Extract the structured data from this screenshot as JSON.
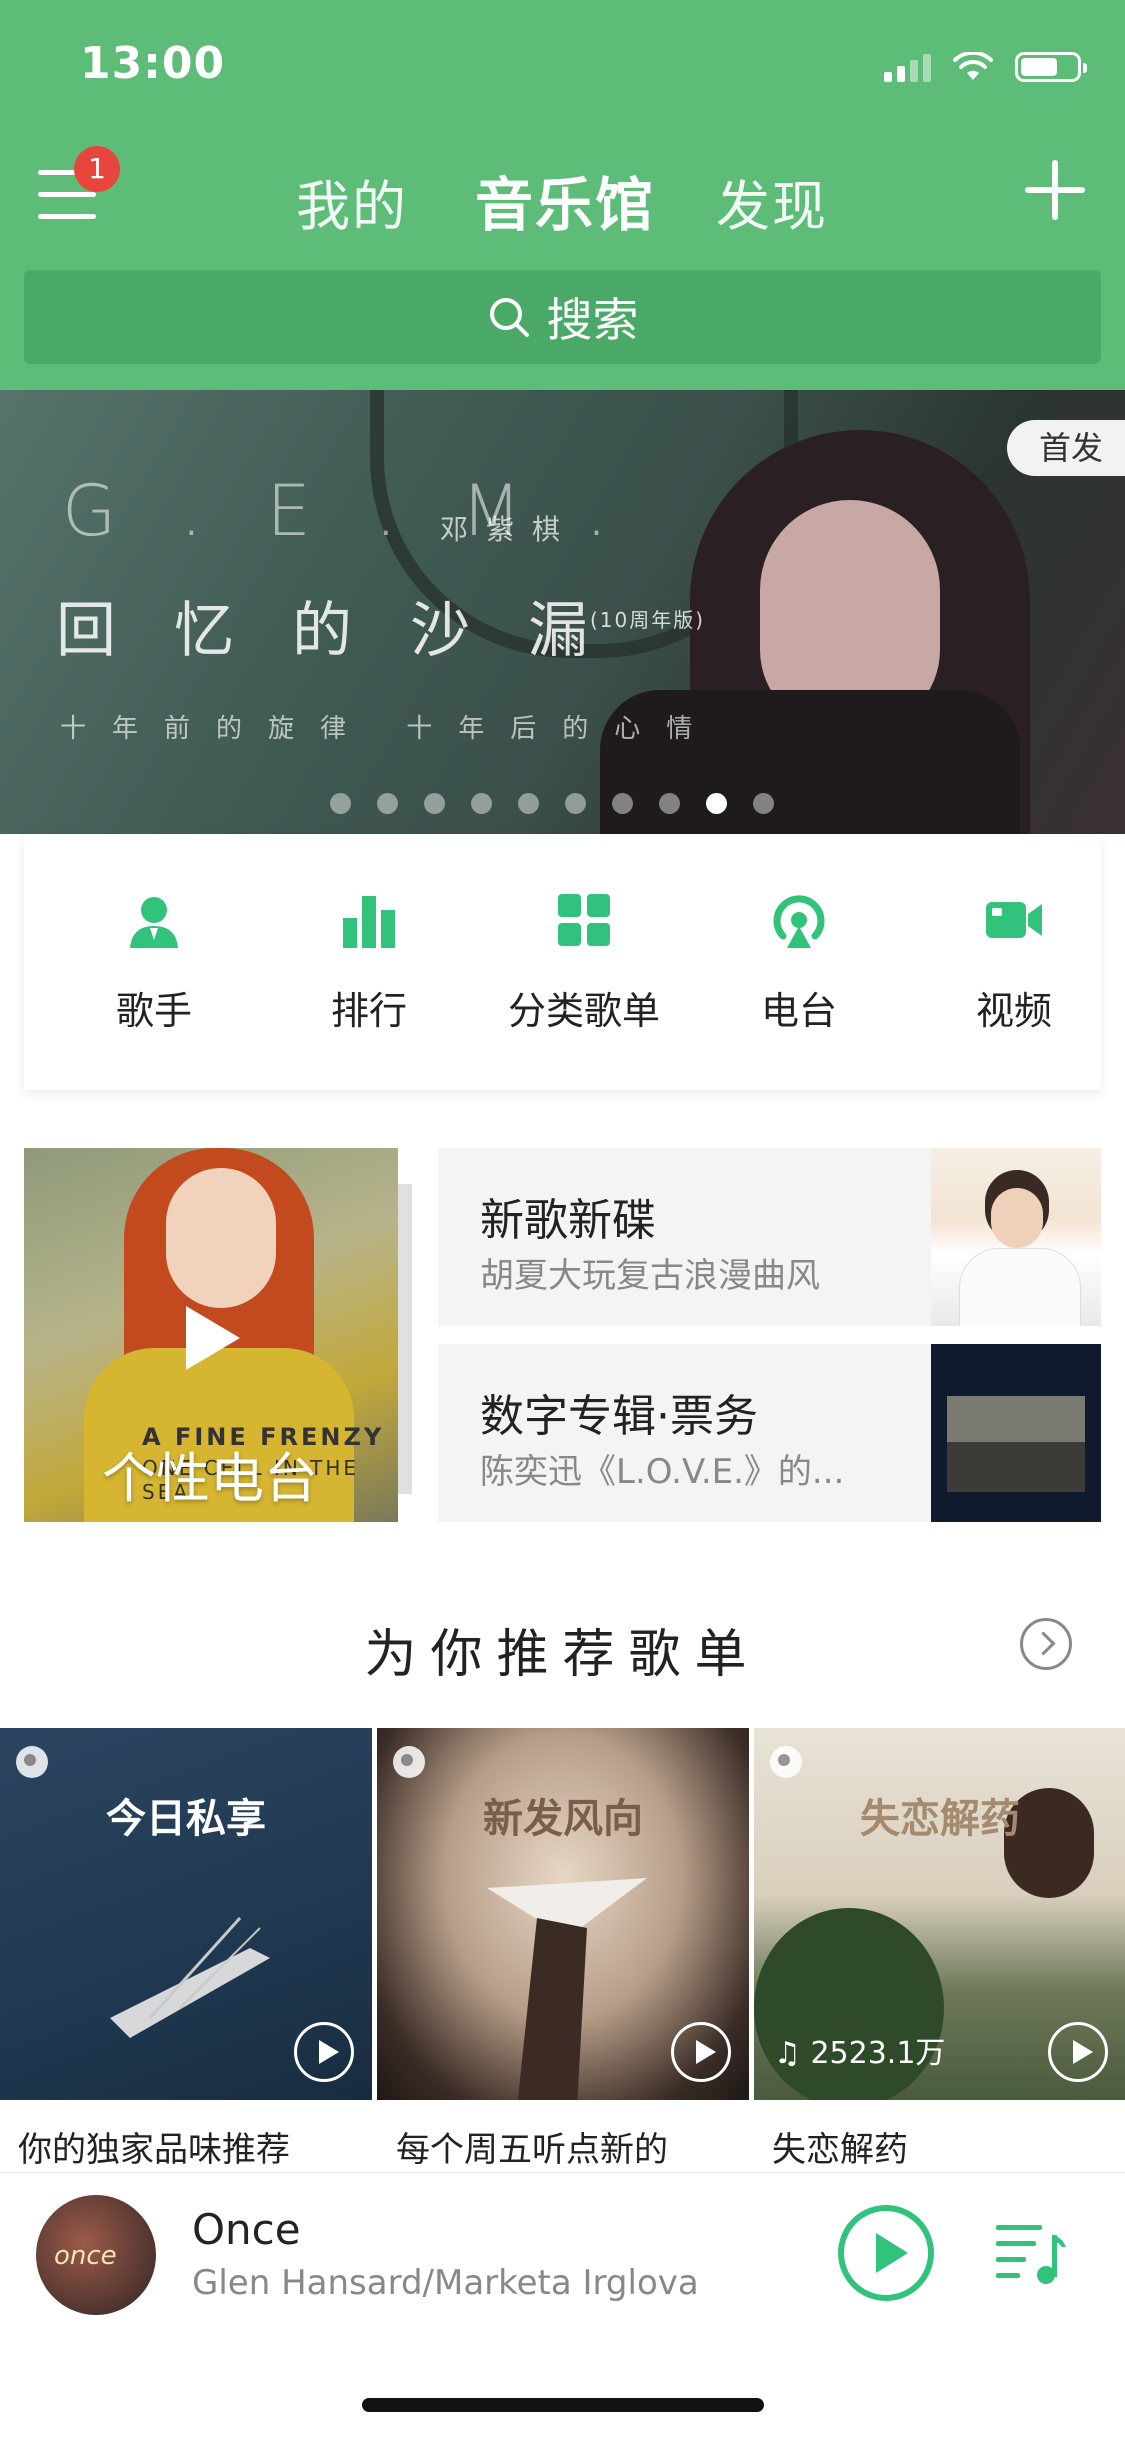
{
  "status": {
    "time": "13:00"
  },
  "header": {
    "badge_count": "1",
    "tabs": [
      {
        "label": "我的",
        "active": false
      },
      {
        "label": "音乐馆",
        "active": true
      },
      {
        "label": "发现",
        "active": false
      }
    ],
    "search_label": "搜索",
    "accent_color": "#5dbd78"
  },
  "banner": {
    "tag": "首发",
    "artist_latin": "G.E.M.",
    "artist_cn": "邓紫棋",
    "title": "回忆的沙漏",
    "edition": "(10周年版)",
    "subtitle": "十年前的旋律 十年后的心情",
    "page_count": 10,
    "active_page": 9
  },
  "quick_nav": [
    {
      "label": "歌手",
      "icon": "singer-icon"
    },
    {
      "label": "排行",
      "icon": "chart-icon"
    },
    {
      "label": "分类歌单",
      "icon": "category-icon"
    },
    {
      "label": "电台",
      "icon": "radio-icon"
    },
    {
      "label": "视频",
      "icon": "video-icon"
    }
  ],
  "feature": {
    "radio_label": "个性电台",
    "album_line1": "A FINE FRENZY",
    "album_line2": "ONE CELL IN THE SEA",
    "cards": [
      {
        "title": "新歌新碟",
        "subtitle": "胡夏大玩复古浪漫曲风"
      },
      {
        "title": "数字专辑·票务",
        "subtitle": "陈奕迅《L.O.V.E.》的..."
      }
    ]
  },
  "recommend": {
    "title": "为你推荐歌单",
    "playlists": [
      {
        "cover_label": "今日私享",
        "name": "你的独家品味推荐",
        "count": ""
      },
      {
        "cover_label": "新发风向",
        "name": "每个周五听点新的",
        "count": ""
      },
      {
        "cover_label": "失恋解药",
        "name": "失恋解药",
        "count": "2523.1万"
      }
    ]
  },
  "player": {
    "song": "Once",
    "artist": "Glen Hansard/Marketa Irglova",
    "cover_text": "once",
    "play_color": "#31c27c"
  }
}
